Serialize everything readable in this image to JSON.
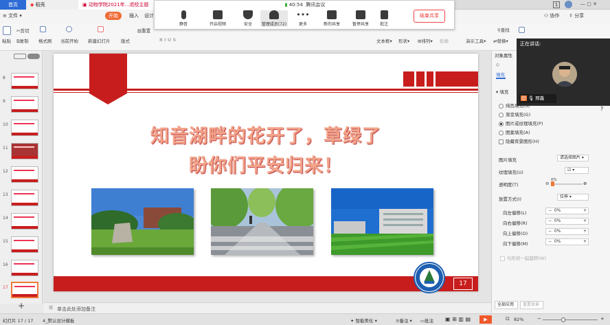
{
  "titlebar": {
    "tabs": [
      "首页",
      "稻壳",
      "动物学院2021年...退校主题会"
    ],
    "page_badge": "1"
  },
  "ribbon": {
    "menus": [
      "文件",
      "开始",
      "插入",
      "设计",
      "协作",
      "分享"
    ],
    "search": "查找"
  },
  "tools": {
    "paste": "粘贴",
    "cut": "剪切",
    "copy": "复制",
    "format_painter": "格式刷",
    "start_from_current": "当前开始",
    "new_slide": "新建幻灯片",
    "layout": "版式",
    "reset": "重置",
    "textbox": "文本框",
    "shape": "形状",
    "arrange": "排列",
    "outline": "轮廓",
    "presenter": "演示工具",
    "replace": "替换",
    "select": "选择"
  },
  "meeting": {
    "time": "40:54",
    "app": "腾讯会议",
    "buttons": [
      {
        "label": "静音",
        "icon": "microphone-icon"
      },
      {
        "label": "开启视频",
        "icon": "video-off-icon"
      },
      {
        "label": "安全",
        "icon": "shield-icon"
      },
      {
        "label": "管理成员(72)",
        "icon": "members-icon"
      },
      {
        "label": "更多",
        "icon": "more-icon"
      },
      {
        "label": "新的共享",
        "icon": "share-icon"
      },
      {
        "label": "暂停共享",
        "icon": "pause-icon"
      },
      {
        "label": "批注",
        "icon": "annotate-icon"
      }
    ],
    "end_share": "结束共享"
  },
  "thumbnails": [
    "8",
    "9",
    "10",
    "11",
    "12",
    "13",
    "14",
    "15",
    "16",
    "17"
  ],
  "slide": {
    "title_line1": "知音湖畔的花开了，草绿了",
    "title_line2": "盼你们平安归来！",
    "page_num": "17",
    "logo_text": "YANGTZE UNIVERSITY"
  },
  "notes": {
    "placeholder": "单击此处添加备注"
  },
  "rightpanel": {
    "title": "对象属性",
    "tab": "填充",
    "section": "填充",
    "options": [
      "纯色填充(S)",
      "渐变填充(G)",
      "图片或纹理填充(P)",
      "图案填充(A)"
    ],
    "selected_option": 2,
    "hide_bg": "隐藏背景图形(H)",
    "picture_fill_label": "图片填充",
    "picture_fill_value": "请选择图片",
    "texture_label": "纹理填充(U)",
    "transparency_label": "透明度(T)",
    "transparency_value": "0%",
    "placement_label": "放置方式(I)",
    "placement_value": "拉伸",
    "offsets": [
      {
        "label": "向左偏移(L)",
        "value": "0%"
      },
      {
        "label": "向右偏移(R)",
        "value": "0%"
      },
      {
        "label": "向上偏移(O)",
        "value": "0%"
      },
      {
        "label": "向下偏移(M)",
        "value": "0%"
      }
    ],
    "rotate_with_shape": "与形状一起旋转(W)",
    "apply_all": "全部应用",
    "reset_bg": "重置背景"
  },
  "video": {
    "speaking": "正在讲话:",
    "name": "邢鑫"
  },
  "statusbar": {
    "slide_count": "幻灯片 17 / 17",
    "theme": "4_默认设计模板",
    "smart_beautify": "智能美化",
    "notes": "备注",
    "comment": "批注",
    "zoom": "82%"
  },
  "colors": {
    "accent_red": "#c81d1d",
    "wps_orange": "#f06a35",
    "title_pink": "#f2a48a"
  }
}
